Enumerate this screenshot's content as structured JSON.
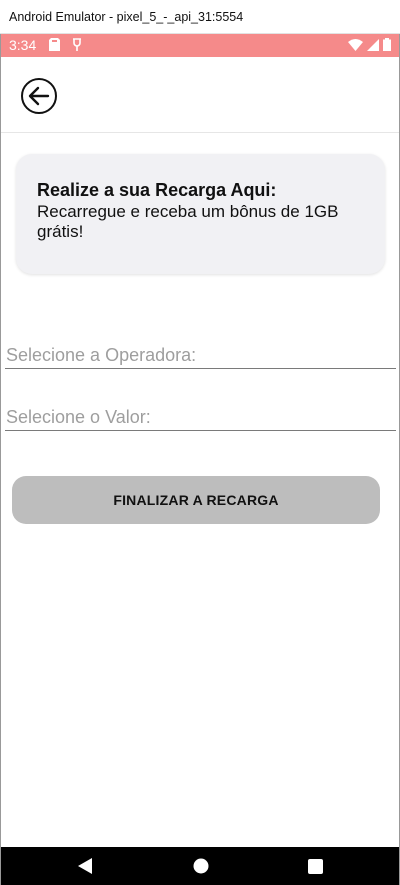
{
  "window": {
    "title": "Android Emulator - pixel_5_-_api_31:5554"
  },
  "statusbar": {
    "time": "3:34",
    "background": "#f58a8a"
  },
  "promo": {
    "title": "Realize a sua Recarga Aqui:",
    "text": "Recarregue e receba um bônus de 1GB grátis!"
  },
  "form": {
    "operadora_placeholder": "Selecione a Operadora:",
    "valor_placeholder": "Selecione o Valor:",
    "submit_label": "FINALIZAR A RECARGA"
  },
  "icons": {
    "back": "arrow-left-circle-icon",
    "nav_back": "triangle-back-icon",
    "nav_home": "circle-home-icon",
    "nav_recents": "square-recents-icon"
  }
}
